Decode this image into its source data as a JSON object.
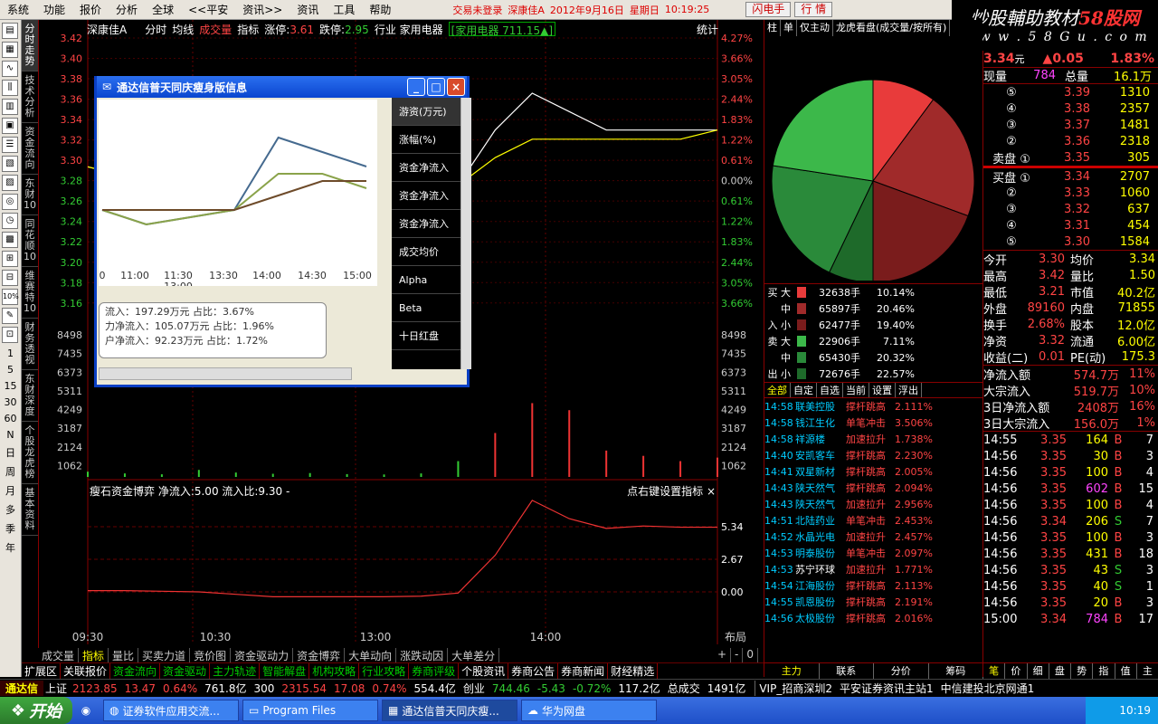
{
  "menu": [
    "系统",
    "功能",
    "报价",
    "分析",
    "全球",
    "<<平安",
    "资讯>>",
    "资讯",
    "工具",
    "帮助"
  ],
  "status": {
    "login": "交易未登录",
    "stock": "深康佳A",
    "date": "2012年9月16日",
    "weekday": "星期日",
    "time": "10:19:25",
    "btn1": "闪电手",
    "btn2": "行 情"
  },
  "brand": {
    "line1a": "炒股輔助教材",
    "line1b": "58股网",
    "line2": "w w w . 5 8 G u . c o m"
  },
  "left_toolbar": {
    "pct": "10%",
    "periods": [
      "1",
      "5",
      "15",
      "30",
      "60",
      "N",
      "日",
      "周",
      "月",
      "多",
      "季",
      "年"
    ]
  },
  "vertical_tabs": [
    "分时走势",
    "技术分析",
    "资金流向",
    "东财10",
    "同花顺10",
    "维赛特10",
    "财务透视",
    "东财深度",
    "个股龙虎榜",
    "基本资料"
  ],
  "chart_header": {
    "name": "深康佳A",
    "t1": "分时",
    "t2": "均线",
    "t3": "成交量",
    "t4": "指标",
    "up": "涨停:3.61",
    "down": "跌停:2.95",
    "industry": "行业 家用电器",
    "sector": "[家用电器 711.15▲]",
    "stat": "统计"
  },
  "y_left": [
    "3.42",
    "3.40",
    "3.38",
    "3.36",
    "3.34",
    "3.32",
    "3.30",
    "3.28",
    "3.26",
    "3.24",
    "3.22",
    "3.20",
    "3.18",
    "3.16"
  ],
  "y_right": [
    "4.27%",
    "3.66%",
    "3.05%",
    "2.44%",
    "1.83%",
    "1.22%",
    "0.61%",
    "0.00%",
    "0.61%",
    "1.22%",
    "1.83%",
    "2.44%",
    "3.05%",
    "3.66%"
  ],
  "vol_left": [
    "8498",
    "7435",
    "6373",
    "5311",
    "4249",
    "3187",
    "2124",
    "1062"
  ],
  "vol_right": [
    "8498",
    "7435",
    "6373",
    "5311",
    "4249",
    "3187",
    "2124",
    "1062"
  ],
  "indicator": {
    "title": "瘦石资金博弈",
    "net": "净流入:5.00",
    "ratio": "流入比:9.30",
    "extra": "-",
    "hint": "点右键设置指标",
    "close": "×",
    "right": [
      "5.34",
      "2.67",
      "0.00"
    ]
  },
  "x_axis": [
    "09:30",
    "10:30",
    "13:00",
    "14:00",
    "布局"
  ],
  "bottom_tabs": [
    "成交量",
    "指标",
    "量比",
    "买卖力道",
    "竞价图",
    "资金驱动力",
    "资金博弈",
    "大单动向",
    "涨跌动因",
    "大单差分"
  ],
  "bottom_ctrl": [
    "+",
    "-",
    "0"
  ],
  "navbar": [
    "扩展区",
    "关联报价",
    "资金流向",
    "资金驱动",
    "主力轨迹",
    "智能解盘",
    "机构攻略",
    "行业攻略",
    "券商评级",
    "个股资讯",
    "券商公告",
    "券商新闻",
    "财经精选"
  ],
  "navbar_right": "资讯工场",
  "right_tabs_bottom": [
    "主力",
    "联系",
    "分价",
    "筹码"
  ],
  "quote_tabs_bottom": [
    "笔",
    "价",
    "细",
    "盘",
    "势",
    "指",
    "值",
    "主"
  ],
  "index_bar": {
    "logo": "通达信",
    "sh_name": "上证",
    "sh": "2123.85",
    "sh_chg": "13.47",
    "sh_pct": "0.64%",
    "sh_amt": "761.8亿",
    "n300": "300",
    "n300v": "2315.54",
    "n300c": "17.08",
    "n300p": "0.74%",
    "n300a": "554.4亿",
    "cy": "创业",
    "cyv": "744.46",
    "cyc": "-5.43",
    "cyp": "-0.72%",
    "cya": "117.2亿",
    "total": "总成交",
    "totalv": "1491亿",
    "vip": "VIP_招商深圳2",
    "site": "平安证券资讯主站1",
    "site2": "中信建投北京网通1"
  },
  "taskbar": {
    "start": "开始",
    "items": [
      "证券软件应用交流...",
      "Program Files",
      "通达信普天同庆瘦...",
      "华为网盘"
    ],
    "time": "10:19"
  },
  "dialog": {
    "title": "通达信普天同庆瘦身版信息",
    "btns": {
      "min": "_",
      "max": "□",
      "close": "×"
    },
    "x_labels": [
      "0",
      "11:00",
      "11:30",
      "13:30",
      "14:00",
      "14:30",
      "15:00"
    ],
    "x_sub": "13:00",
    "info": [
      "流入：197.29万元 占比：3.67%",
      "力净流入：105.07万元 占比：1.96%",
      "户净流入：92.23万元  占比：1.72%"
    ],
    "menu": [
      "游资(万元)",
      "涨幅(%)",
      "资金净流入",
      "资金净流入",
      "资金净流入",
      "成交均价",
      "Alpha",
      "Beta",
      "十日红盘"
    ],
    "chart_data": {
      "type": "line",
      "x": [
        "10:30",
        "11:00",
        "11:30",
        "13:30",
        "14:00",
        "14:30",
        "15:00"
      ],
      "series": [
        {
          "values": [
            3.24,
            3.22,
            3.23,
            3.24,
            3.34,
            3.32,
            3.3
          ]
        },
        {
          "values": [
            3.24,
            3.22,
            3.23,
            3.24,
            3.29,
            3.29,
            3.27
          ]
        },
        {
          "values": [
            3.24,
            3.24,
            3.24,
            3.24,
            3.26,
            3.28,
            3.28
          ]
        }
      ],
      "ylim": [
        3.18,
        3.38
      ]
    }
  },
  "pie": {
    "tabs": [
      "柱",
      "单",
      "仅主动",
      "龙虎看盘(成交量/按所有)"
    ],
    "chart_data": {
      "type": "pie",
      "values": [
        10.14,
        20.46,
        19.4,
        7.11,
        20.32,
        22.57
      ],
      "colors": [
        "#e83b3b",
        "#a02a2a",
        "#7a1c1c",
        "#1e6a2a",
        "#2a8a3a",
        "#3cb84a"
      ]
    }
  },
  "flows": [
    {
      "side": "买",
      "size": "大",
      "val": "32638手",
      "pct": "10.14%",
      "color": "#e83b3b"
    },
    {
      "side": "",
      "size": "中",
      "val": "65897手",
      "pct": "20.46%",
      "color": "#a02a2a"
    },
    {
      "side": "入",
      "size": "小",
      "val": "62477手",
      "pct": "19.40%",
      "color": "#7a1c1c"
    },
    {
      "side": "卖",
      "size": "大",
      "val": "22906手",
      "pct": "7.11%",
      "color": "#3cb84a"
    },
    {
      "side": "",
      "size": "中",
      "val": "65430手",
      "pct": "20.32%",
      "color": "#2a8a3a"
    },
    {
      "side": "出",
      "size": "小",
      "val": "72676手",
      "pct": "22.57%",
      "color": "#1e6a2a"
    }
  ],
  "news_tabs": [
    "全部",
    "自定",
    "自选",
    "当前",
    "设置",
    "浮出"
  ],
  "news": [
    {
      "t": "14:58",
      "n": "联美控股",
      "e": "撑杆跳高",
      "p": "2.111%"
    },
    {
      "t": "14:58",
      "n": "钱江生化",
      "e": "单笔冲击",
      "p": "3.506%"
    },
    {
      "t": "14:58",
      "n": "祥源楼",
      "e": "加速拉升",
      "p": "1.738%"
    },
    {
      "t": "14:40",
      "n": "安凯客车",
      "e": "撑杆跳高",
      "p": "2.230%"
    },
    {
      "t": "14:41",
      "n": "双星新材",
      "e": "撑杆跳高",
      "p": "2.005%"
    },
    {
      "t": "14:43",
      "n": "陕天然气",
      "e": "撑杆跳高",
      "p": "2.094%"
    },
    {
      "t": "14:43",
      "n": "陕天然气",
      "e": "加速拉升",
      "p": "2.956%"
    },
    {
      "t": "14:51",
      "n": "北陆药业",
      "e": "单笔冲击",
      "p": "2.453%"
    },
    {
      "t": "14:52",
      "n": "水晶光电",
      "e": "加速拉升",
      "p": "2.457%"
    },
    {
      "t": "14:53",
      "n": "明泰股份",
      "e": "单笔冲击",
      "p": "2.097%"
    },
    {
      "t": "14:53",
      "n": "苏宁环球",
      "e": "加速拉升",
      "p": "1.771%"
    },
    {
      "t": "14:54",
      "n": "江海股份",
      "e": "撑杆跳高",
      "p": "2.113%"
    },
    {
      "t": "14:55",
      "n": "凯恩股份",
      "e": "撑杆跳高",
      "p": "2.191%"
    },
    {
      "t": "14:56",
      "n": "太极股份",
      "e": "撑杆跳高",
      "p": "2.016%"
    }
  ],
  "quote": {
    "price": "3.34",
    "unit": "元",
    "chg": "▲0.05",
    "pct": "1.83%",
    "now_l": "现量",
    "now": "784",
    "tot_l": "总量",
    "tot": "16.1万",
    "sells": [
      {
        "n": "⑤",
        "p": "3.39",
        "v": "1310"
      },
      {
        "n": "④",
        "p": "3.38",
        "v": "2357"
      },
      {
        "n": "③",
        "p": "3.37",
        "v": "1481"
      },
      {
        "n": "②",
        "p": "3.36",
        "v": "2318"
      },
      {
        "n": "卖盘 ①",
        "p": "3.35",
        "v": "305"
      }
    ],
    "buys": [
      {
        "n": "买盘 ①",
        "p": "3.34",
        "v": "2707"
      },
      {
        "n": "②",
        "p": "3.33",
        "v": "1060"
      },
      {
        "n": "③",
        "p": "3.32",
        "v": "637"
      },
      {
        "n": "④",
        "p": "3.31",
        "v": "454"
      },
      {
        "n": "⑤",
        "p": "3.30",
        "v": "1584"
      }
    ],
    "stats": [
      [
        "今开",
        "3.30",
        "均价",
        "3.34"
      ],
      [
        "最高",
        "3.42",
        "量比",
        "1.50"
      ],
      [
        "最低",
        "3.21",
        "市值",
        "40.2亿"
      ],
      [
        "外盘",
        "89160",
        "内盘",
        "71855"
      ],
      [
        "换手",
        "2.68%",
        "股本",
        "12.0亿"
      ],
      [
        "净资",
        "3.32",
        "流通",
        "6.00亿"
      ],
      [
        "收益(二)",
        "0.01",
        "PE(动)",
        "175.3"
      ]
    ],
    "flowstats": [
      [
        "净流入额",
        "574.7万",
        "11%"
      ],
      [
        "大宗流入",
        "519.7万",
        "10%"
      ],
      [
        "3日净流入额",
        "2408万",
        "16%"
      ],
      [
        "3日大宗流入",
        "156.0万",
        "1%"
      ]
    ],
    "ticks": [
      [
        "14:55",
        "3.35",
        "164",
        "B",
        "7"
      ],
      [
        "14:56",
        "3.35",
        "30",
        "B",
        "3"
      ],
      [
        "14:56",
        "3.35",
        "100",
        "B",
        "4"
      ],
      [
        "14:56",
        "3.35",
        "602",
        "B",
        "15"
      ],
      [
        "14:56",
        "3.35",
        "100",
        "B",
        "4"
      ],
      [
        "14:56",
        "3.34",
        "206",
        "S",
        "7"
      ],
      [
        "14:56",
        "3.35",
        "100",
        "B",
        "3"
      ],
      [
        "14:56",
        "3.35",
        "431",
        "B",
        "18"
      ],
      [
        "14:56",
        "3.35",
        "43",
        "S",
        "3"
      ],
      [
        "14:56",
        "3.35",
        "40",
        "S",
        "1"
      ],
      [
        "14:56",
        "3.35",
        "20",
        "B",
        "3"
      ],
      [
        "15:00",
        "3.34",
        "784",
        "B",
        "17"
      ]
    ]
  },
  "main_chart": {
    "chart_data": {
      "type": "line",
      "x_range": [
        "09:30",
        "15:00"
      ],
      "series": [
        {
          "values": [
            3.3,
            3.29,
            3.28,
            3.27,
            3.26,
            3.26,
            3.26,
            3.26,
            3.26,
            3.27,
            3.28,
            3.34,
            3.38,
            3.36,
            3.34,
            3.34,
            3.34,
            3.34
          ]
        },
        {
          "values": [
            3.3,
            3.29,
            3.28,
            3.28,
            3.27,
            3.27,
            3.27,
            3.27,
            3.27,
            3.27,
            3.28,
            3.31,
            3.33,
            3.33,
            3.33,
            3.33,
            3.33,
            3.34
          ]
        }
      ],
      "ylim": [
        3.14,
        3.44
      ],
      "volumes": [
        300,
        200,
        150,
        400,
        250,
        180,
        220,
        160,
        140,
        200,
        900,
        2500,
        4200,
        3800,
        1500,
        1200,
        900,
        1100
      ]
    }
  }
}
